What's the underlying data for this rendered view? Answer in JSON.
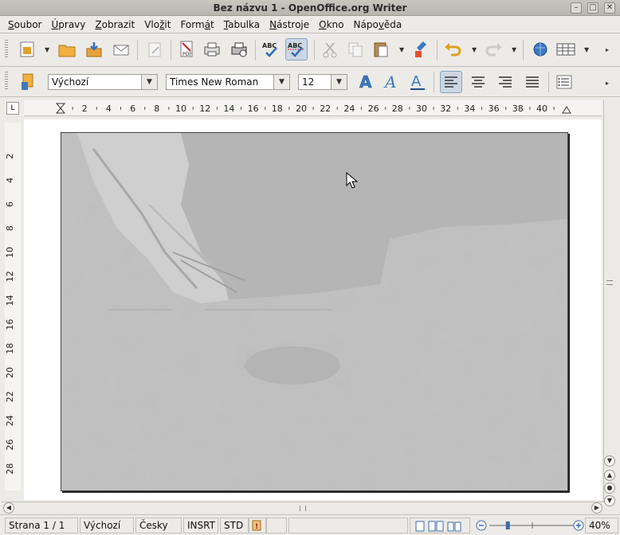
{
  "window": {
    "title": "Bez názvu 1 - OpenOffice.org Writer"
  },
  "menu": [
    {
      "pre": "",
      "ul": "S",
      "post": "oubor"
    },
    {
      "pre": "",
      "ul": "Ú",
      "post": "pravy"
    },
    {
      "pre": "",
      "ul": "Z",
      "post": "obrazit"
    },
    {
      "pre": "Vlo",
      "ul": "ž",
      "post": "it"
    },
    {
      "pre": "Form",
      "ul": "á",
      "post": "t"
    },
    {
      "pre": "",
      "ul": "T",
      "post": "abulka"
    },
    {
      "pre": "",
      "ul": "N",
      "post": "ástroje"
    },
    {
      "pre": "",
      "ul": "O",
      "post": "kno"
    },
    {
      "pre": "Nápo",
      "ul": "v",
      "post": "ěda"
    }
  ],
  "formatting": {
    "style": "Výchozí",
    "font": "Times New Roman",
    "size": "12"
  },
  "rulers": {
    "horizontal": [
      "2",
      "4",
      "6",
      "8",
      "10",
      "12",
      "14",
      "16",
      "18",
      "20",
      "22",
      "24",
      "26",
      "28",
      "30",
      "32",
      "34",
      "36",
      "38",
      "40"
    ],
    "vertical": [
      "2",
      "4",
      "6",
      "8",
      "10",
      "12",
      "14",
      "16",
      "18",
      "20",
      "22",
      "24",
      "26",
      "28"
    ]
  },
  "status": {
    "page": "Strana 1 / 1",
    "style": "Výchozí",
    "language": "Česky",
    "insert_mode": "INSRT",
    "selection_mode": "STD",
    "zoom": "40%",
    "zoom_level": 0.4
  },
  "icons": [
    "styles-icon",
    "open-folder-icon",
    "save-icon",
    "email-icon",
    "edit-file-icon",
    "export-pdf-icon",
    "print-icon",
    "print-preview-icon",
    "spellcheck-icon",
    "autospellcheck-icon",
    "cut-icon",
    "copy-icon",
    "paste-icon",
    "clone-format-icon",
    "undo-icon",
    "redo-icon",
    "navigator-icon",
    "table-icon",
    "bold-icon",
    "italic-icon",
    "underline-icon",
    "align-left-icon",
    "align-center-icon",
    "align-right-icon",
    "justify-icon",
    "bullet-list-icon"
  ],
  "colors": {
    "accent": "#2f6fb8",
    "chrome": "#edebe7",
    "page_bg": "#bdbdbd"
  }
}
